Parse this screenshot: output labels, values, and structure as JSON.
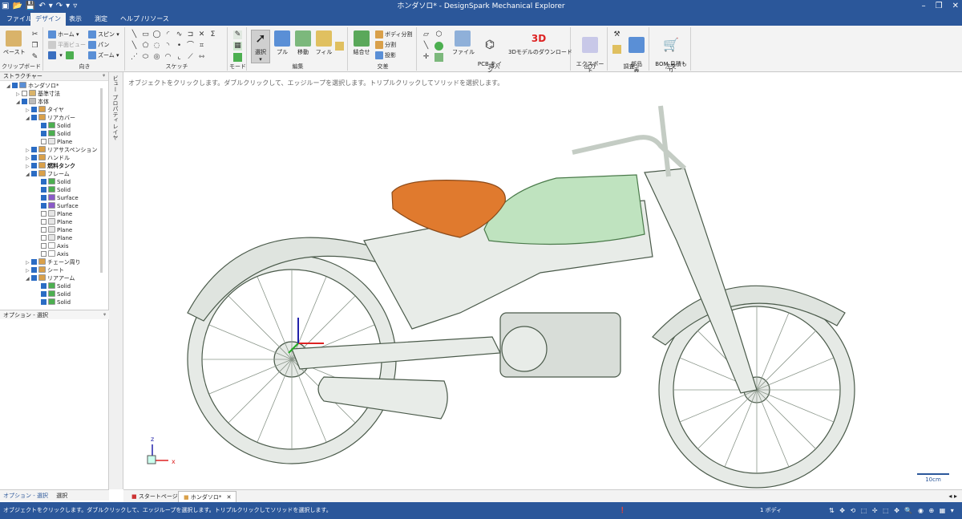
{
  "window": {
    "title": "ホンダソロ* - DesignSpark Mechanical Explorer",
    "minimize": "–",
    "maximize": "❐",
    "close": "✕"
  },
  "qat": [
    "▣",
    "📂",
    "💾",
    "↶",
    "▾",
    "↷",
    "▾",
    "▿"
  ],
  "tabs": [
    "ファイル",
    "デザイン",
    "表示",
    "測定",
    "ヘルプ /リソース"
  ],
  "ribbon": {
    "clipboard": {
      "paste": "ペースト",
      "group": "クリップボード"
    },
    "orient": {
      "home": "ホーム",
      "plane_view": "平面ビュー",
      "spin": "スピン",
      "pan": "パン",
      "zoom": "ズーム",
      "group": "向き"
    },
    "sketch": {
      "group": "スケッチ"
    },
    "mode": {
      "group": "モード"
    },
    "edit": {
      "select": "選択",
      "pull": "プル",
      "move": "移動",
      "fill": "フィル",
      "group": "編集"
    },
    "intersect": {
      "combine": "結合せ",
      "split_body": "ボディ分割",
      "split": "分割",
      "project": "投影",
      "group": "交差"
    },
    "insert": {
      "file": "ファイル",
      "pcb": "PCB をイン\nポート",
      "download3d": "3Dモデルのダウンロード",
      "group": "挿入"
    },
    "output": {
      "export": "エクスポート\nオプション",
      "group": "出力"
    },
    "survey": {
      "parts": "部品\n表",
      "group": "調査"
    },
    "order": {
      "bom": "BOM 見積も\nり",
      "group": "注文"
    }
  },
  "structure": {
    "header": "ストラクチャー",
    "pin": "ᵠ"
  },
  "tree": [
    {
      "d": 0,
      "exp": "◢",
      "cb": true,
      "ic": "#5a8fd6",
      "t": "ホンダソロ*"
    },
    {
      "d": 1,
      "exp": "▷",
      "cb": false,
      "ic": "#d9b36a",
      "t": "基準寸法"
    },
    {
      "d": 1,
      "exp": "◢",
      "cb": true,
      "ic": "#bbbbbb",
      "t": "本体"
    },
    {
      "d": 2,
      "exp": "▷",
      "cb": true,
      "ic": "#d9a04a",
      "t": "タイヤ"
    },
    {
      "d": 2,
      "exp": "◢",
      "cb": true,
      "ic": "#d9a04a",
      "t": "リアカバー"
    },
    {
      "d": 3,
      "exp": "",
      "cb": true,
      "ic": "#4caf50",
      "t": "Solid"
    },
    {
      "d": 3,
      "exp": "",
      "cb": true,
      "ic": "#4caf50",
      "t": "Solid"
    },
    {
      "d": 3,
      "exp": "",
      "cb": false,
      "ic": "#e6e6e6",
      "t": "Plane"
    },
    {
      "d": 2,
      "exp": "▷",
      "cb": true,
      "ic": "#d9a04a",
      "t": "リアサスペンション"
    },
    {
      "d": 2,
      "exp": "▷",
      "cb": true,
      "ic": "#d9a04a",
      "t": "ハンドル"
    },
    {
      "d": 2,
      "exp": "▷",
      "cb": true,
      "ic": "#d9a04a",
      "t": "燃料タンク",
      "bold": true
    },
    {
      "d": 2,
      "exp": "◢",
      "cb": true,
      "ic": "#d9a04a",
      "t": "フレーム"
    },
    {
      "d": 3,
      "exp": "",
      "cb": true,
      "ic": "#4caf50",
      "t": "Solid"
    },
    {
      "d": 3,
      "exp": "",
      "cb": true,
      "ic": "#4caf50",
      "t": "Solid"
    },
    {
      "d": 3,
      "exp": "",
      "cb": true,
      "ic": "#8a5ac8",
      "t": "Surface"
    },
    {
      "d": 3,
      "exp": "",
      "cb": true,
      "ic": "#8a5ac8",
      "t": "Surface"
    },
    {
      "d": 3,
      "exp": "",
      "cb": false,
      "ic": "#e6e6e6",
      "t": "Plane"
    },
    {
      "d": 3,
      "exp": "",
      "cb": false,
      "ic": "#e6e6e6",
      "t": "Plane"
    },
    {
      "d": 3,
      "exp": "",
      "cb": false,
      "ic": "#e6e6e6",
      "t": "Plane"
    },
    {
      "d": 3,
      "exp": "",
      "cb": false,
      "ic": "#e6e6e6",
      "t": "Plane"
    },
    {
      "d": 3,
      "exp": "",
      "cb": false,
      "ic": "#ffffff",
      "t": "Axis"
    },
    {
      "d": 3,
      "exp": "",
      "cb": false,
      "ic": "#ffffff",
      "t": "Axis"
    },
    {
      "d": 2,
      "exp": "▷",
      "cb": true,
      "ic": "#d9a04a",
      "t": "チェーン周り"
    },
    {
      "d": 2,
      "exp": "▷",
      "cb": true,
      "ic": "#d9a04a",
      "t": "シート"
    },
    {
      "d": 2,
      "exp": "◢",
      "cb": true,
      "ic": "#d9a04a",
      "t": "リアアーム"
    },
    {
      "d": 3,
      "exp": "",
      "cb": true,
      "ic": "#4caf50",
      "t": "Solid"
    },
    {
      "d": 3,
      "exp": "",
      "cb": true,
      "ic": "#4caf50",
      "t": "Solid"
    },
    {
      "d": 3,
      "exp": "",
      "cb": true,
      "ic": "#4caf50",
      "t": "Solid"
    }
  ],
  "options": {
    "header": "オプション - 選択",
    "pin": "ᵠ"
  },
  "bottom_tabs": [
    "オプション - 選択",
    "選択"
  ],
  "side_tabs": [
    "ビュー",
    "プロパティ",
    "レイヤ"
  ],
  "viewport": {
    "hint": "オブジェクトをクリックします。ダブルクリックして、エッジループを選択します。トリプルクリックしてソリッドを選択します。",
    "scale": "10cm",
    "axis_x": "x",
    "axis_y": "y",
    "axis_z": "z"
  },
  "doc_tabs": [
    {
      "label": "スタートページ",
      "close": ""
    },
    {
      "label": "ホンダソロ*",
      "close": "✕"
    }
  ],
  "doc_nav": "◂ ▸",
  "status": {
    "message": "オブジェクトをクリックします。ダブルクリックして、エッジループを選択します。トリプルクリックしてソリッドを選択します。",
    "warning": "❗",
    "bodies": "1 ボディ",
    "tools": "⇅ ✥ ⟲ ⬚ ✢ ⬚ ✥ 🔍 ◉ ⊕ ▦ ▾"
  },
  "colors": {
    "accent": "#2b579a",
    "seat": "#e07a2e",
    "tank": "#bfe3bf",
    "body": "#e8ece8"
  }
}
